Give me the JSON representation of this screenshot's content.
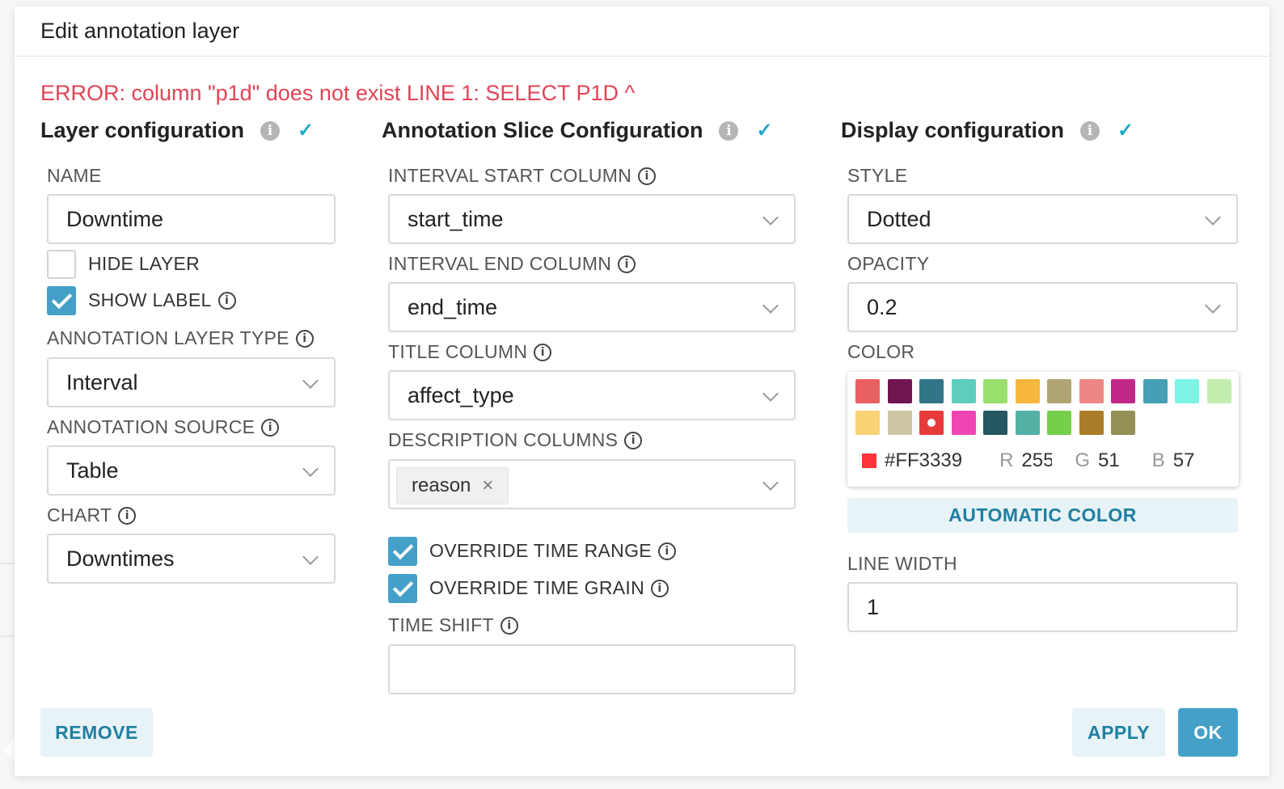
{
  "dialog": {
    "title": "Edit annotation layer",
    "error": "ERROR: column \"p1d\" does not exist LINE 1: SELECT P1D ^"
  },
  "layer_config": {
    "title": "Layer configuration",
    "name_label": "NAME",
    "name_value": "Downtime",
    "hide_layer_label": "HIDE LAYER",
    "hide_layer_checked": false,
    "show_label_label": "SHOW LABEL",
    "show_label_checked": true,
    "type_label": "ANNOTATION LAYER TYPE",
    "type_value": "Interval",
    "source_label": "ANNOTATION SOURCE",
    "source_value": "Table",
    "chart_label": "CHART",
    "chart_value": "Downtimes"
  },
  "slice_config": {
    "title": "Annotation Slice Configuration",
    "start_label": "INTERVAL START COLUMN",
    "start_value": "start_time",
    "end_label": "INTERVAL END COLUMN",
    "end_value": "end_time",
    "title_col_label": "TITLE COLUMN",
    "title_col_value": "affect_type",
    "desc_label": "DESCRIPTION COLUMNS",
    "desc_tags": [
      "reason"
    ],
    "override_range_label": "OVERRIDE TIME RANGE",
    "override_range_checked": true,
    "override_grain_label": "OVERRIDE TIME GRAIN",
    "override_grain_checked": true,
    "time_shift_label": "TIME SHIFT",
    "time_shift_value": ""
  },
  "display_config": {
    "title": "Display configuration",
    "style_label": "STYLE",
    "style_value": "Dotted",
    "opacity_label": "OPACITY",
    "opacity_value": "0.2",
    "color_label": "COLOR",
    "swatches": [
      "#e8605f",
      "#6f1650",
      "#337588",
      "#5ecdc0",
      "#99df6d",
      "#f7b63d",
      "#b0a572",
      "#ee8686",
      "#c1288a",
      "#459fb5",
      "#7df3e6",
      "#c3eeb0",
      "#f9d273",
      "#ccc6a3",
      "#e73b3b",
      "#ef45b4",
      "#255763",
      "#52b1a4",
      "#76cf4a",
      "#aa7d28",
      "#958f58"
    ],
    "selected_swatch_index": 14,
    "hex": "#FF3339",
    "r_label": "R",
    "r_value": "255",
    "g_label": "G",
    "g_value": "51",
    "b_label": "B",
    "b_value": "57",
    "auto_color_label": "AUTOMATIC COLOR",
    "line_width_label": "LINE WIDTH",
    "line_width_value": "1"
  },
  "footer": {
    "remove_label": "REMOVE",
    "apply_label": "APPLY",
    "ok_label": "OK"
  },
  "icons": {
    "info_filled": "info-circle-filled-icon",
    "info_outline": "info-circle-outline-icon",
    "check": "check-icon",
    "chevron": "chevron-down-icon",
    "close": "close-icon"
  },
  "colors": {
    "accent": "#45a0c8",
    "error": "#e04355",
    "check": "#20a7c9"
  }
}
